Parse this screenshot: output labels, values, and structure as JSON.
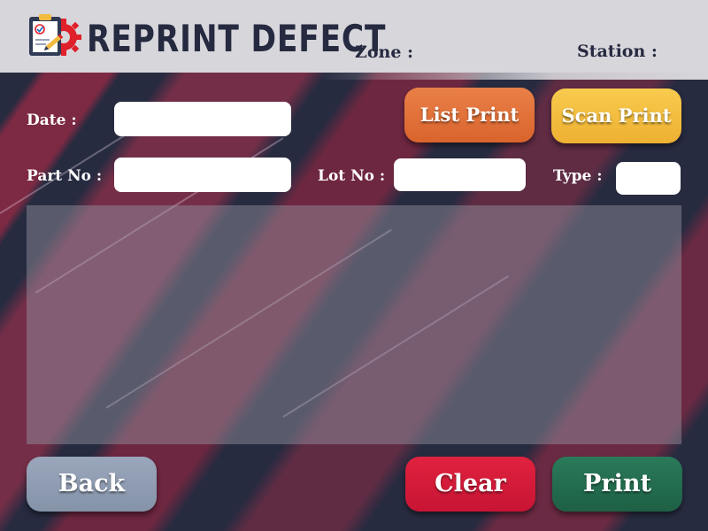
{
  "header": {
    "title": "REPRINT DEFECT",
    "zone_label": "Zone :",
    "station_label": "Station :"
  },
  "form": {
    "date_label": "Date :",
    "date_value": "",
    "part_no_label": "Part No :",
    "part_no_value": "",
    "lot_no_label": "Lot No :",
    "lot_no_value": "",
    "type_label": "Type :",
    "type_value": ""
  },
  "buttons": {
    "list_print": "List Print",
    "scan_print": "Scan Print",
    "back": "Back",
    "clear": "Clear",
    "print": "Print"
  },
  "colors": {
    "header_bg": "#d7d6db",
    "title_text": "#262a40",
    "list_print": "#e0703a",
    "scan_print": "#f2bb3f",
    "back": "#8f9bb0",
    "clear": "#d61a3c",
    "print": "#236b4f",
    "background": "#272b40"
  },
  "icons": {
    "logo": "clipboard-gear-icon"
  }
}
